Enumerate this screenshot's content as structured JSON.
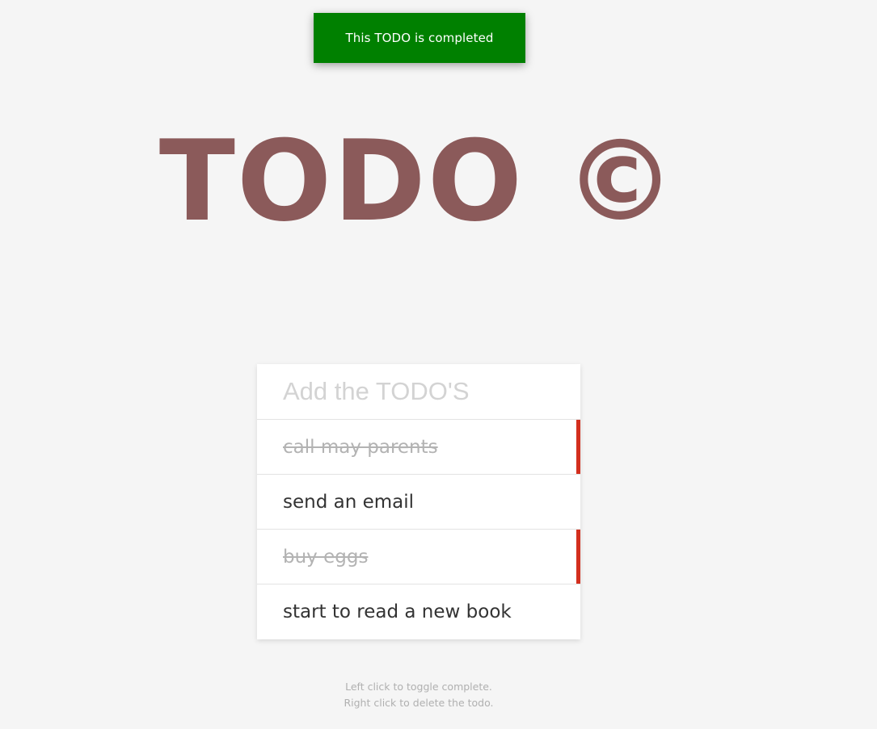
{
  "toast": {
    "message": "This TODO is completed",
    "color": "#008000"
  },
  "title": "TODO ©",
  "input": {
    "placeholder": "Add the TODO'S",
    "value": ""
  },
  "todos": [
    {
      "text": "call may parents",
      "completed": true
    },
    {
      "text": "send an email",
      "completed": false
    },
    {
      "text": "buy eggs",
      "completed": true
    },
    {
      "text": "start to read a new book",
      "completed": false
    }
  ],
  "hint": {
    "line1": "Left click to toggle complete.",
    "line2": "Right click to delete the todo."
  },
  "colors": {
    "title": "#8b5a5a",
    "completed_marker": "#d32f1e",
    "background": "#f5f5f5"
  }
}
